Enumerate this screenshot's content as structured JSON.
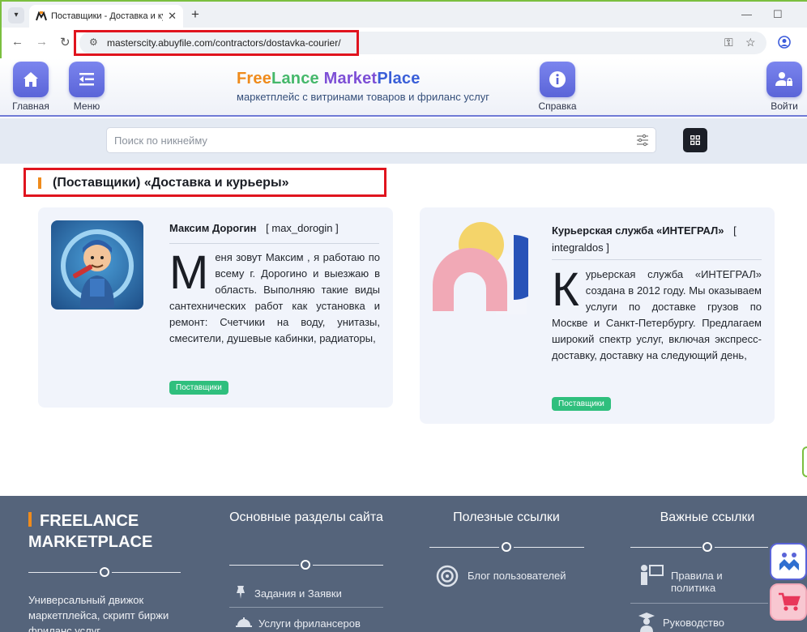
{
  "browser": {
    "tab_title": "Поставщики - Доставка и курьеры",
    "new_tab": "+",
    "url": "masterscity.abuyfile.com/contractors/dostavka-courier/"
  },
  "header": {
    "home_label": "Главная",
    "menu_label": "Меню",
    "help_label": "Справка",
    "login_label": "Войти",
    "logo": {
      "free": "Free",
      "lance": "Lance",
      "market": "Market",
      "place": "Place"
    },
    "tagline": "маркетплейс с витринами товаров и фриланс услуг"
  },
  "search": {
    "placeholder": "Поиск по никнейму"
  },
  "section": {
    "title": "(Поставщики) «Доставка и курьеры»"
  },
  "cards": [
    {
      "name": "Максим Дорогин",
      "nick": "[ max_dorogin ]",
      "dropcap": "М",
      "description": "еня зовут Максим , я работаю по всему г. Дорогино и выезжаю в область. Выполняю такие виды сантехнических работ как установка и ремонт: Счетчики на воду, унитазы, смесители, душевые кабинки, радиаторы,",
      "badge": "Поставщики"
    },
    {
      "name": "Курьерская служба «ИНТЕГРАЛ»",
      "nick_open": "[",
      "nick": "integraldos ]",
      "dropcap": "К",
      "description": "урьерская служба «ИНТЕГРАЛ» создана в 2012 году. Мы оказываем услуги по доставке грузов по Москве и Санкт-Петербургу. Предлагаем широкий спектр услуг, включая экспресс-доставку, доставку на следующий день,",
      "badge": "Поставщики"
    }
  ],
  "footer": {
    "brand_line1": "FREELANCE",
    "brand_line2": "MARKETPLACE",
    "brand_text": "Универсальный движок маркетплейса, скрипт биржи фриланс услуг",
    "col1_title": "Основные разделы сайта",
    "col1_links": [
      "Задания и Заявки",
      "Услуги фрилансеров"
    ],
    "col2_title": "Полезные ссылки",
    "col2_links": [
      "Блог пользователей"
    ],
    "col3_title": "Важные ссылки",
    "col3_links": [
      "Правила и политика",
      "Руководство"
    ]
  },
  "colors": {
    "accent": "#5a64d8",
    "orange": "#ef8b1c",
    "green": "#2fbf7d",
    "highlight": "#e0141e",
    "footer": "#55647b"
  }
}
